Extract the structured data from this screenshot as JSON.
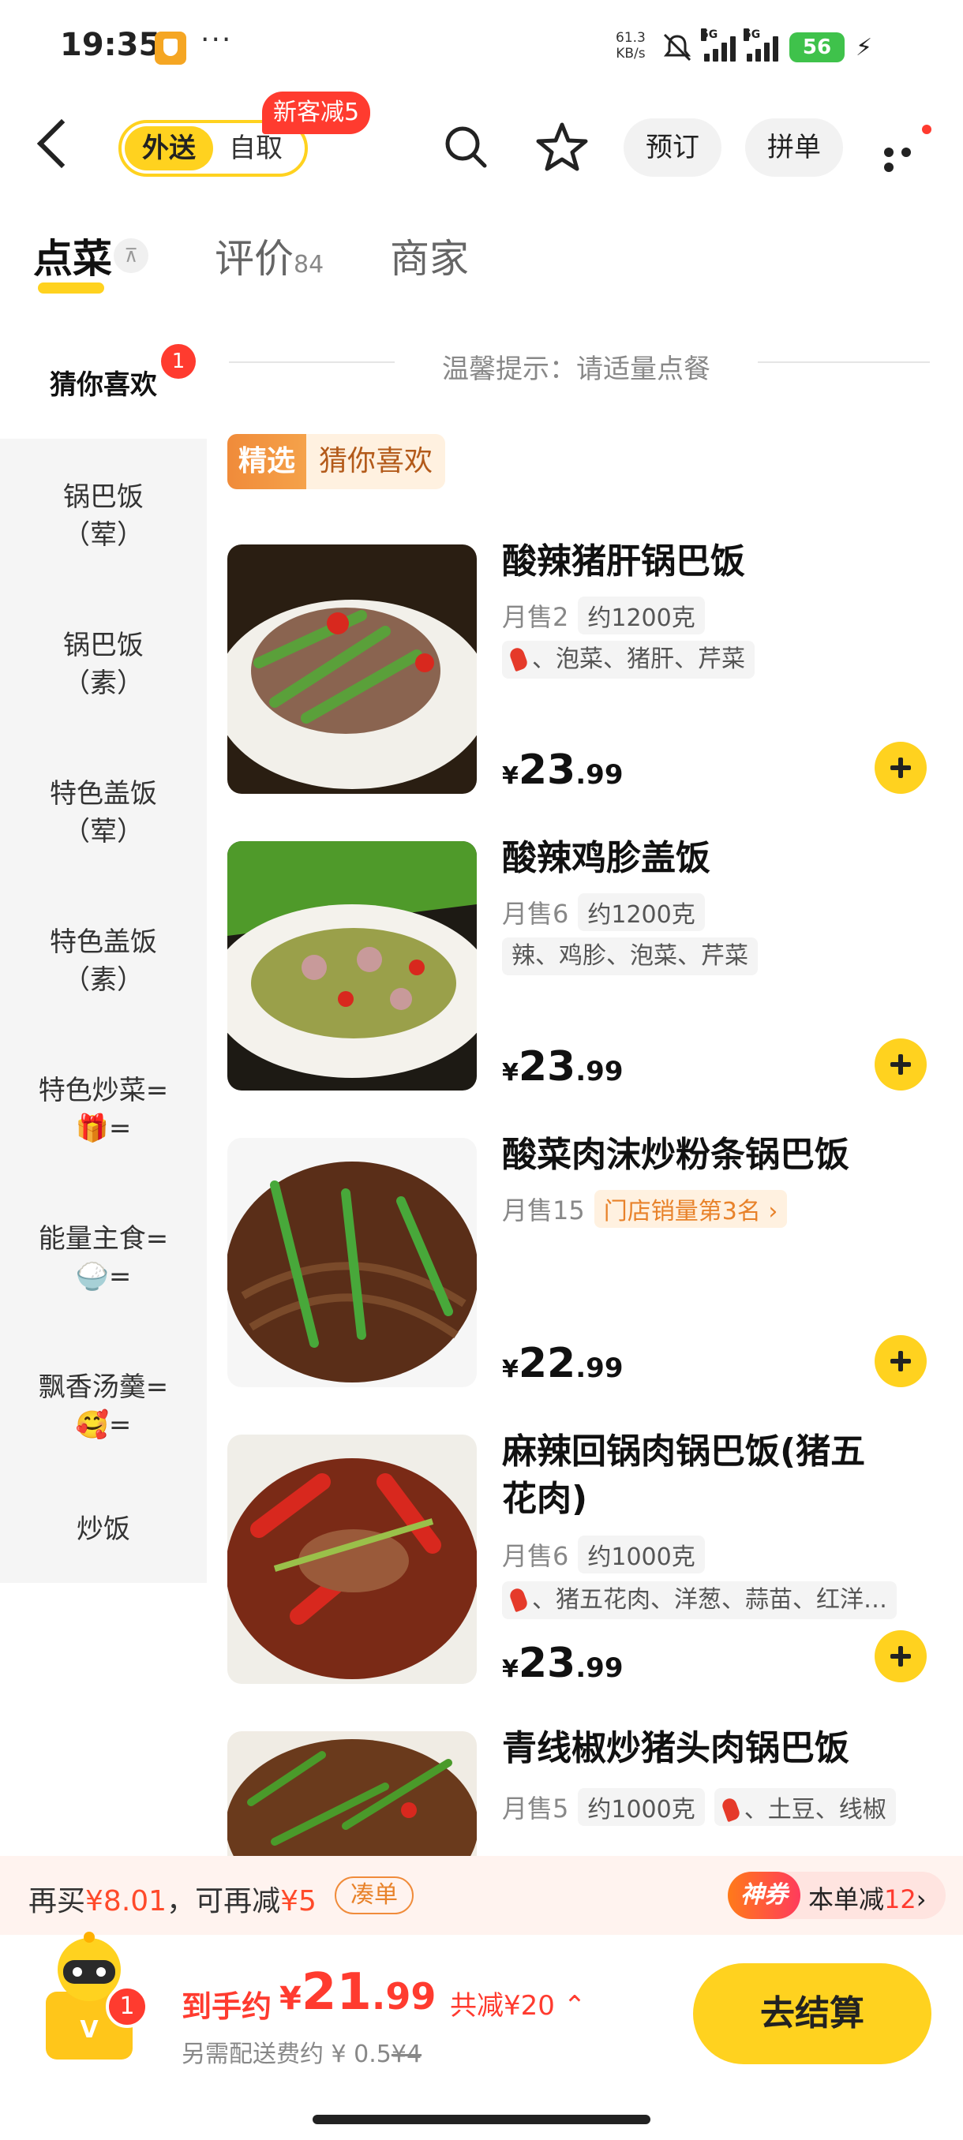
{
  "status_bar": {
    "time": "19:35",
    "more": "···",
    "speed_value": "61.3",
    "speed_unit": "KB/s",
    "network_1": "5G",
    "network_2": "5G",
    "battery": "56"
  },
  "header": {
    "mode_delivery": "外送",
    "mode_pickup": "自取",
    "promo_badge": "新客减5",
    "reserve_label": "预订",
    "group_label": "拼单"
  },
  "tabs": [
    {
      "label": "点菜"
    },
    {
      "label": "评价",
      "count": "84"
    },
    {
      "label": "商家"
    }
  ],
  "tip": "温馨提示：请适量点餐",
  "sidebar": {
    "badge": "1",
    "items": [
      {
        "line1": "猜你喜欢",
        "line2": ""
      },
      {
        "line1": "锅巴饭",
        "line2": "（荤）"
      },
      {
        "line1": "锅巴饭",
        "line2": "（素）"
      },
      {
        "line1": "特色盖饭",
        "line2": "（荤）"
      },
      {
        "line1": "特色盖饭",
        "line2": "（素）"
      },
      {
        "line1": "特色炒菜=",
        "line2": "🎁="
      },
      {
        "line1": "能量主食=",
        "line2": "🍚="
      },
      {
        "line1": "飘香汤羹=",
        "line2": "🥰="
      },
      {
        "line1": "炒饭",
        "line2": ""
      }
    ]
  },
  "section": {
    "tag": "精选",
    "title": "猜你喜欢"
  },
  "dishes": [
    {
      "name": "酸辣猪肝锅巴饭",
      "sales": "月售2",
      "weight": "约1200克",
      "tags": "、泡菜、猪肝、芹菜",
      "price_cur": "¥",
      "price_int": "23",
      "price_dec": ".99"
    },
    {
      "name": "酸辣鸡胗盖饭",
      "sales": "月售6",
      "weight": "约1200克",
      "tags": "辣、鸡胗、泡菜、芹菜",
      "price_cur": "¥",
      "price_int": "23",
      "price_dec": ".99"
    },
    {
      "name": "酸菜肉沫炒粉条锅巴饭",
      "sales": "月售15",
      "rank": "门店销量第3名 ›",
      "price_cur": "¥",
      "price_int": "22",
      "price_dec": ".99"
    },
    {
      "name_line1": "麻辣回锅肉锅巴饭(猪五",
      "name_line2": "花肉)",
      "sales": "月售6",
      "weight": "约1000克",
      "tags": "、猪五花肉、洋葱、蒜苗、红洋…",
      "price_cur": "¥",
      "price_int": "23",
      "price_dec": ".99"
    },
    {
      "name": "青线椒炒猪头肉锅巴饭",
      "sales": "月售5",
      "weight": "约1000克",
      "tags": "、土豆、线椒"
    }
  ],
  "promo_strip": {
    "prefix": "再买",
    "amount": "¥8.01",
    "middle": "，可再减",
    "discount": "¥5",
    "action": "凑单",
    "coupon_tag": "神券",
    "coupon_text": "本单减",
    "coupon_amount": "12",
    "coupon_arrow": "›"
  },
  "checkout": {
    "cart_count": "1",
    "total_label": "到手约",
    "total_cur": "¥",
    "total_int": "21",
    "total_dec": ".99",
    "saved": "共减¥20 ⌃",
    "fee_prefix": "另需配送费约 ¥ 0.5",
    "fee_original": "¥4",
    "button": "去结算"
  },
  "colors": {
    "accent": "#ffd21f",
    "price_red": "#ff3b2f",
    "orange": "#e8822a"
  }
}
